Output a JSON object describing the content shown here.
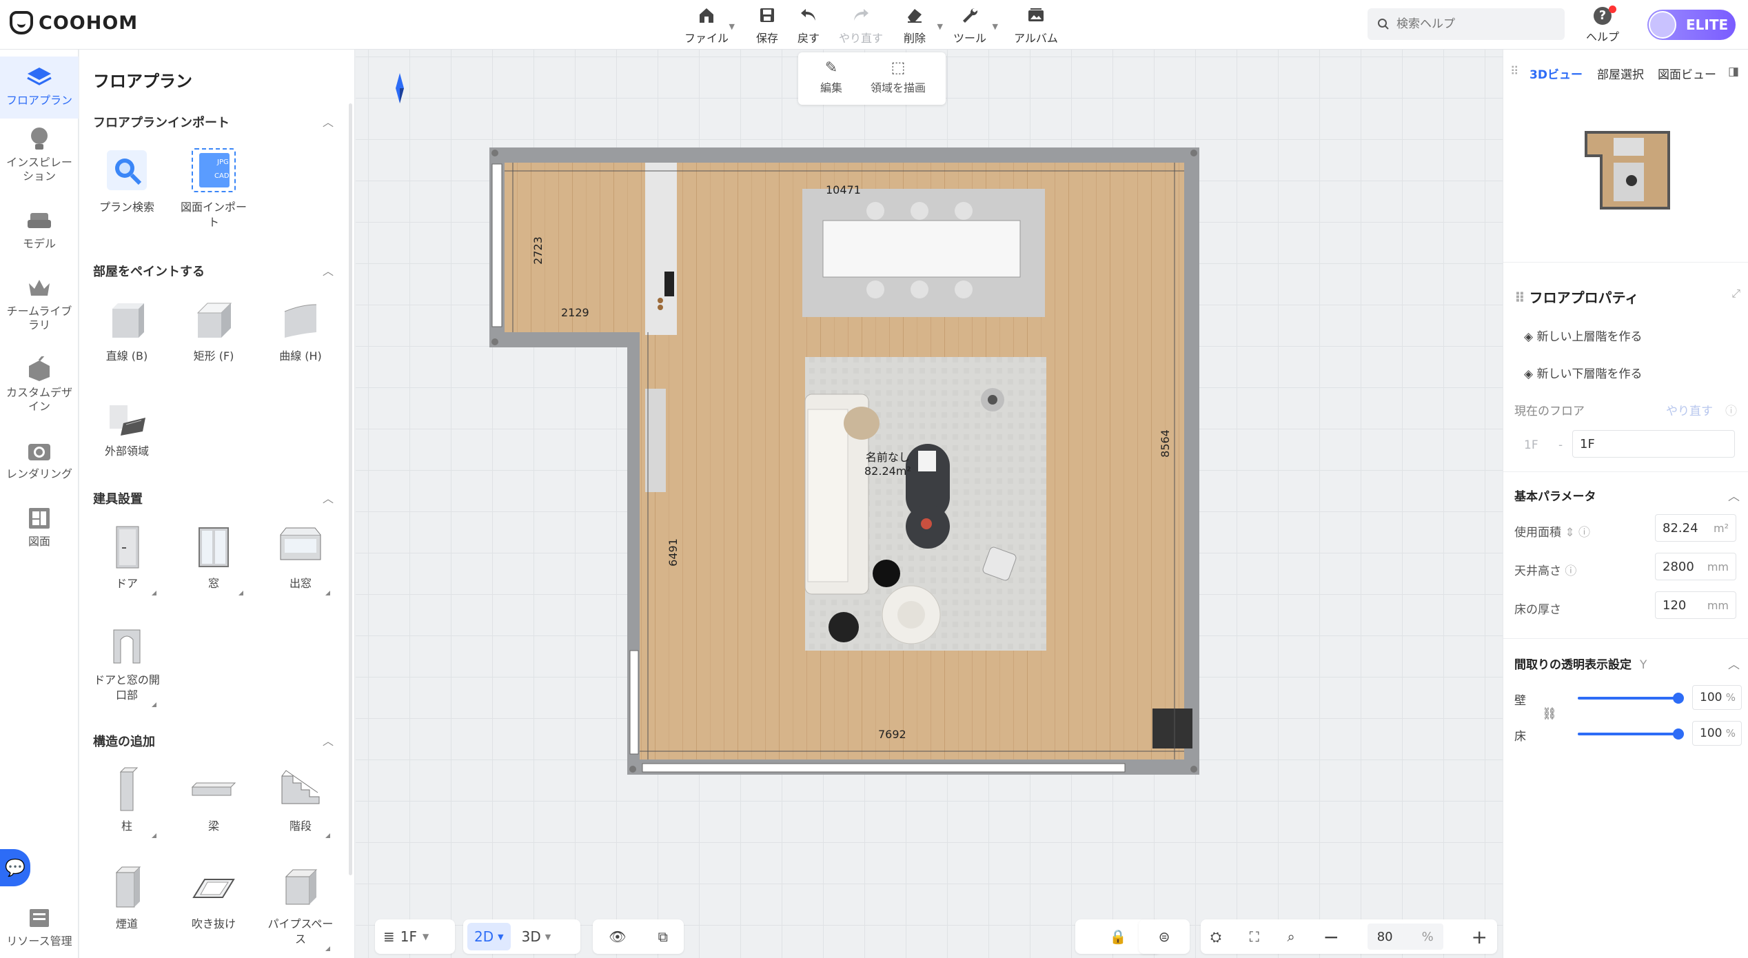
{
  "app": {
    "logo_text": "COOHOM"
  },
  "toolbar": {
    "file": "ファイル",
    "save": "保存",
    "undo": "戻す",
    "redo": "やり直す",
    "delete": "削除",
    "tools": "ツール",
    "album": "アルバム"
  },
  "search": {
    "placeholder": "検索ヘルプ"
  },
  "help": {
    "label": "ヘルプ"
  },
  "user": {
    "tier": "ELITE"
  },
  "leftnav": {
    "items": [
      {
        "label": "フロアプラン",
        "icon": "floorplan-icon"
      },
      {
        "label": "インスピレーション",
        "icon": "lightbulb-icon"
      },
      {
        "label": "モデル",
        "icon": "sofa-icon"
      },
      {
        "label": "チームライブラリ",
        "icon": "crown-icon"
      },
      {
        "label": "カスタムデザイン",
        "icon": "custom-design-icon"
      },
      {
        "label": "レンダリング",
        "icon": "camera-icon"
      },
      {
        "label": "図面",
        "icon": "drawing-icon"
      },
      {
        "label": "リソース管理",
        "icon": "resource-icon"
      }
    ]
  },
  "library": {
    "title": "フロアプラン",
    "sections": {
      "import": {
        "title": "フロアプランインポート",
        "items": [
          "プラン検索",
          "図面インポート"
        ]
      },
      "paint": {
        "title": "部屋をペイントする",
        "items": [
          "直線 (B)",
          "矩形 (F)",
          "曲線 (H)",
          "外部領域"
        ]
      },
      "fixtures": {
        "title": "建具設置",
        "items": [
          "ドア",
          "窓",
          "出窓",
          "ドアと窓の開口部"
        ]
      },
      "structure": {
        "title": "構造の追加",
        "items": [
          "柱",
          "梁",
          "階段",
          "煙道",
          "吹き抜け",
          "パイプスペース"
        ]
      }
    }
  },
  "editbar": {
    "edit": "編集",
    "draw_region": "領域を描画"
  },
  "floorplan": {
    "dims": {
      "top": "10471",
      "left_upper": "2723",
      "notch": "2129",
      "right": "8564",
      "left_lower": "6491",
      "bottom": "7692"
    },
    "room_name": "名前なし",
    "room_area": "82.24m²"
  },
  "bottom": {
    "floor": "1F",
    "mode_2d": "2D",
    "mode_3d": "3D",
    "zoom": "80",
    "zoom_unit": "%"
  },
  "right": {
    "tabs": [
      "3Dビュー",
      "部屋選択",
      "図面ビュー"
    ],
    "props_title": "フロアプロパティ",
    "new_upper": "新しい上層階を作る",
    "new_lower": "新しい下層階を作る",
    "current_floor_label": "現在のフロア",
    "redo_link": "やり直す",
    "floor_index": "1F",
    "floor_name": "1F",
    "basic_params": "基本パラメータ",
    "usable_area_label": "使用面積",
    "usable_area": "82.24",
    "area_unit": "m²",
    "ceiling_label": "天井高さ",
    "ceiling": "2800",
    "floor_thick_label": "床の厚さ",
    "floor_thick": "120",
    "mm": "mm",
    "transparency_title": "間取りの透明表示設定",
    "transparency_hotkey": "Y",
    "wall_label": "壁",
    "wall_value": "100",
    "floor_label": "床",
    "floor_value": "100",
    "pct": "%"
  }
}
